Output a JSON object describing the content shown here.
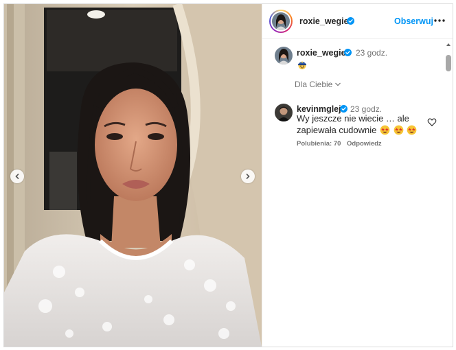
{
  "post": {
    "author": {
      "username": "roxie_wegiel",
      "verified": true,
      "follow_label": "Obserwuj",
      "more_icon": "ellipsis-icon"
    },
    "photo": {
      "prev_icon": "chevron-left-icon",
      "next_icon": "chevron-right-icon"
    },
    "caption": {
      "username": "roxie_wegiel",
      "time": "23 godz.",
      "emoji": "police-officer-emoji"
    },
    "comments_filter": {
      "label": "Dla Ciebie",
      "icon": "chevron-down-icon"
    },
    "comments": [
      {
        "username": "kevinmglej",
        "verified": true,
        "time": "23 godz.",
        "text": "Wy jeszcze nie wiecie … ale zapiewała cudownie",
        "emojis": [
          "star-struck-emoji",
          "star-struck-emoji",
          "star-struck-emoji"
        ],
        "likes_label": "Polubienia: 70",
        "reply_label": "Odpowiedz",
        "like_icon": "heart-icon"
      }
    ]
  },
  "colors": {
    "accent": "#0095f6",
    "verified": "#0095f6",
    "secondary_text": "#737373"
  }
}
